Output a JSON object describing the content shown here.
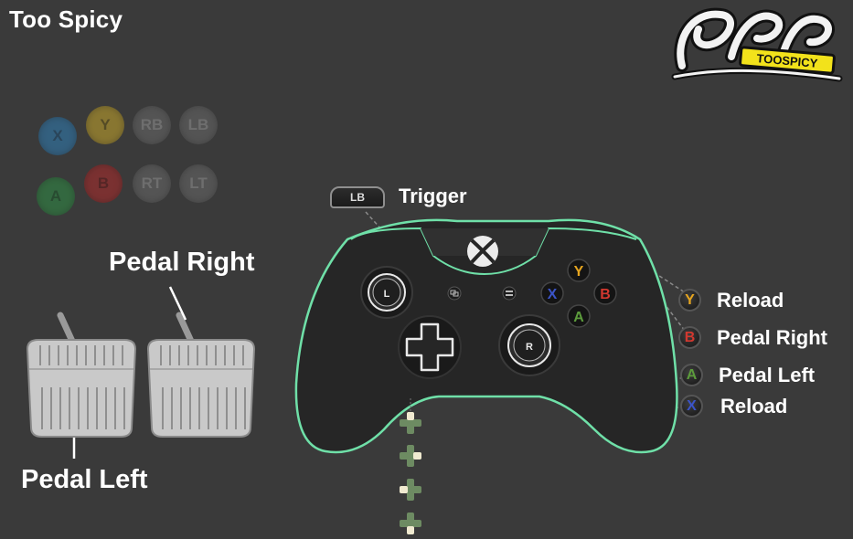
{
  "title": "Too Spicy",
  "logo": {
    "tagline": "TOOSPICY"
  },
  "legend_buttons": [
    {
      "label": "X",
      "color": "#2f7fb8"
    },
    {
      "label": "Y",
      "color": "#c9a82a"
    },
    {
      "label": "RB",
      "color": "#6a6a6a"
    },
    {
      "label": "LB",
      "color": "#6a6a6a"
    },
    {
      "label": "A",
      "color": "#2f8f45"
    },
    {
      "label": "B",
      "color": "#b02a2a"
    },
    {
      "label": "RT",
      "color": "#6a6a6a"
    },
    {
      "label": "LT",
      "color": "#6a6a6a"
    }
  ],
  "pedals": {
    "right_label": "Pedal Right",
    "left_label": "Pedal Left"
  },
  "controller": {
    "trigger_chip": "LB",
    "trigger_label": "Trigger",
    "left_stick": "L",
    "right_stick": "R",
    "face": {
      "y": "Y",
      "b": "B",
      "x": "X",
      "a": "A"
    },
    "colors": {
      "outline": "#6fe0a8",
      "y": "#e6a51f",
      "b": "#d2382f",
      "x": "#3b54c8",
      "a": "#5c9b3c"
    }
  },
  "mapping": [
    {
      "button": "Y",
      "label": "Reload",
      "color": "#e6a51f"
    },
    {
      "button": "B",
      "label": "Pedal Right",
      "color": "#d2382f"
    },
    {
      "button": "A",
      "label": "Pedal Left",
      "color": "#5c9b3c"
    },
    {
      "button": "X",
      "label": "Reload",
      "color": "#3b54c8"
    }
  ]
}
